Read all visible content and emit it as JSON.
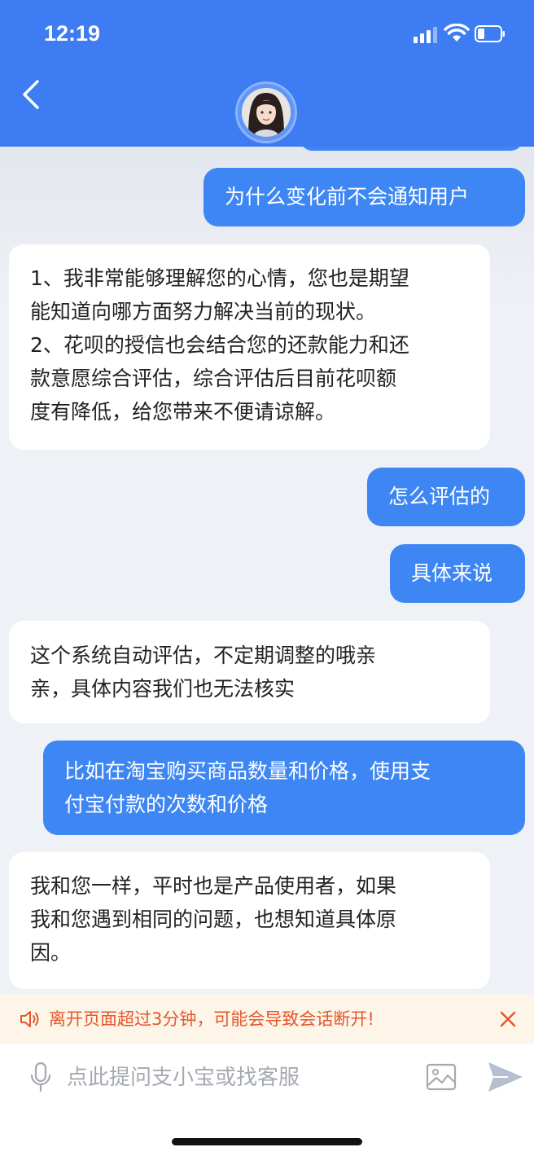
{
  "status_bar": {
    "time": "12:19"
  },
  "header": {
    "back_icon": "chevron-left-icon",
    "avatar": "agent-avatar"
  },
  "messages": [
    {
      "sender": "user",
      "text": "为什么变化前不会通知用户"
    },
    {
      "sender": "agent",
      "lines": [
        "1、我非常能够理解您的心情，您也是期望",
        "能知道向哪方面努力解决当前的现状。",
        "2、花呗的授信也会结合您的还款能力和还",
        "款意愿综合评估，综合评估后目前花呗额",
        "度有降低，给您带来不便请谅解。"
      ]
    },
    {
      "sender": "user",
      "text": "怎么评估的"
    },
    {
      "sender": "user",
      "text": "具体来说"
    },
    {
      "sender": "agent",
      "lines": [
        "这个系统自动评估，不定期调整的哦亲",
        "亲，具体内容我们也无法核实"
      ]
    },
    {
      "sender": "user",
      "lines": [
        "比如在淘宝购买商品数量和价格，使用支",
        "付宝付款的次数和价格"
      ]
    },
    {
      "sender": "agent",
      "lines": [
        "我和您一样，平时也是产品使用者，如果",
        "我和您遇到相同的问题，也想知道具体原",
        "因。"
      ]
    }
  ],
  "notice": {
    "text": "离开页面超过3分钟，可能会导致会话断开!",
    "icon": "speaker-icon",
    "close_icon": "close-icon"
  },
  "input": {
    "placeholder": "点此提问支小宝或找客服",
    "value": ""
  },
  "colors": {
    "brand_blue": "#3d7cf2",
    "user_bubble": "#3d86f3",
    "notice_text": "#e4572d",
    "notice_bg": "#fdf5e7"
  }
}
